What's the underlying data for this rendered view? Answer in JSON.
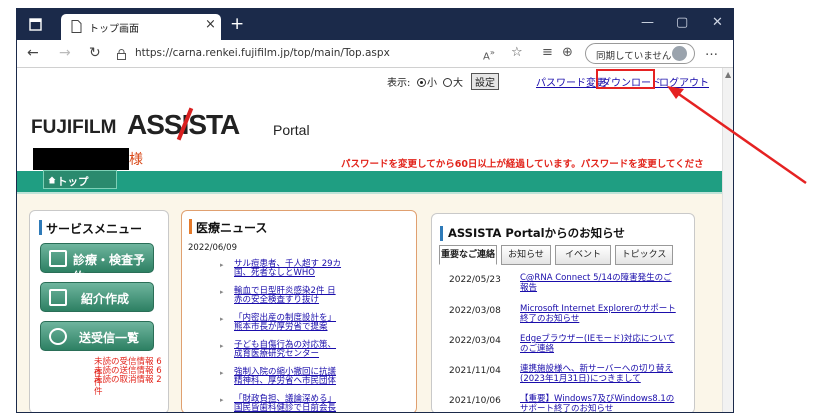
{
  "browser": {
    "tab_title": "トップ画面",
    "tab_close": "×",
    "new_tab": "+",
    "url": "https://carna.renkei.fujifilm.jp/top/main/Top.aspx",
    "profile_label": "同期していません",
    "window_controls": [
      "—",
      "▢",
      "✕"
    ],
    "more": "…"
  },
  "util": {
    "display_label": "表示:",
    "size_small": "小",
    "size_large": "大",
    "settings_button": "設定",
    "change_password": "パスワード変更",
    "download": "ダウンロード",
    "logout": "ログアウト"
  },
  "logo": {
    "fujifilm": "FUJIFILM",
    "assista": "ASSISTA",
    "portal": "Portal"
  },
  "user": {
    "honorific": "様",
    "password_warning": "パスワードを変更してから60日以上が経過しています。パスワードを変更してください。"
  },
  "nav": {
    "top_tab": "トップ"
  },
  "service_menu": {
    "title": "サービスメニュー",
    "items": [
      "診療・検査予約",
      "紹介作成",
      "送受信一覧"
    ],
    "unread": [
      "未読の受信情報 6件",
      "未読の送信情報 6件",
      "未読の取消情報 2件"
    ]
  },
  "news": {
    "title": "医療ニュース",
    "date": "2022/06/09",
    "items": [
      "サル痘患者、千人超す 29カ国、死者なしとWHO",
      "輸血で日型肝炎感染2件 日赤の安全検査すり抜け",
      "「内密出産の制度設計を」 熊本市長が厚労省で提案",
      "子ども自傷行為の対応策、成育医療研究センター",
      "強制入院の縮小撤回に抗議 精神科、厚労省へ市民団体",
      "「財政負担、議論深める」 国民皆歯科健診で日前会長"
    ]
  },
  "announcements": {
    "title": "ASSISTA Portalからのお知らせ",
    "tabs": [
      "重要なご連絡",
      "お知らせ",
      "イベント",
      "トピックス"
    ],
    "items": [
      {
        "date": "2022/05/23",
        "text": "C@RNA Connect 5/14の障害発生のご報告"
      },
      {
        "date": "2022/03/08",
        "text": "Microsoft Internet Explorerのサポート終了のお知らせ"
      },
      {
        "date": "2022/03/04",
        "text": "Edgeブラウザー(IEモード)対応についてのご連絡"
      },
      {
        "date": "2021/11/04",
        "text": "連携施設様へ、新サーバーへの切り替え(2023年1月31日)につきまして"
      },
      {
        "date": "2021/10/06",
        "text": "【重要】Windows7及びWindows8.1のサポート終了のお知らせ"
      }
    ]
  },
  "colors": {
    "titlebar": "#1b2a4a",
    "nav_green": "#1f9e82",
    "warning_red": "#e2231a",
    "highlight_red": "#e52222",
    "link_blue": "#1a0dab"
  }
}
